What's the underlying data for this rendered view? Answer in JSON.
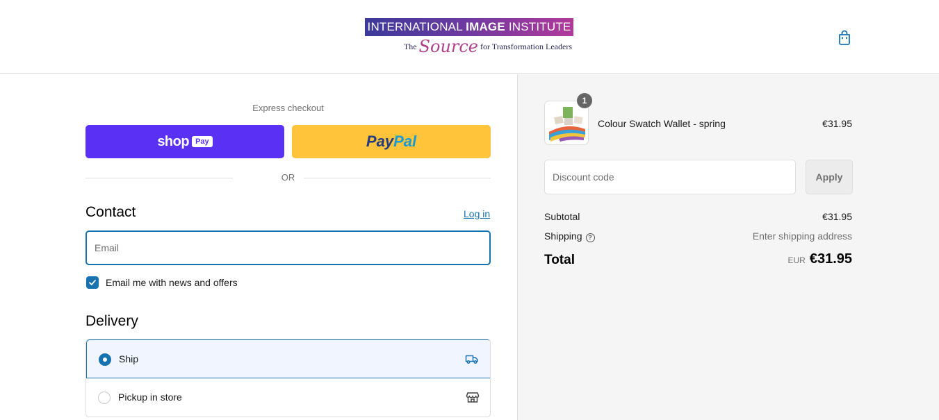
{
  "header": {
    "logo_line1_part1": "INTERNATIONAL ",
    "logo_line1_part2": "IMAGE",
    "logo_line1_part3": " INSTITUTE",
    "logo_line2_the": "The ",
    "logo_line2_source": "Source",
    "logo_line2_rest": " for Transformation Leaders",
    "cart_icon": "shopping-bag-icon"
  },
  "express": {
    "label": "Express checkout",
    "shop_pay_word": "shop",
    "shop_pay_badge": "Pay",
    "paypal_part1": "Pay",
    "paypal_part2": "Pal",
    "or_text": "OR"
  },
  "contact": {
    "heading": "Contact",
    "login_link": "Log in",
    "email_placeholder": "Email",
    "newsletter_label": "Email me with news and offers",
    "newsletter_checked": true
  },
  "delivery": {
    "heading": "Delivery",
    "options": [
      {
        "label": "Ship",
        "selected": true,
        "icon": "truck-icon"
      },
      {
        "label": "Pickup in store",
        "selected": false,
        "icon": "store-icon"
      }
    ]
  },
  "summary": {
    "item": {
      "quantity": "1",
      "name": "Colour Swatch Wallet - spring",
      "price": "€31.95"
    },
    "discount_placeholder": "Discount code",
    "apply_label": "Apply",
    "subtotal_label": "Subtotal",
    "subtotal_value": "€31.95",
    "shipping_label": "Shipping",
    "shipping_value": "Enter shipping address",
    "total_label": "Total",
    "total_currency": "EUR",
    "total_value": "€31.95"
  },
  "colors": {
    "accent": "#1773b0",
    "shop_pay": "#5a31f4",
    "paypal": "#ffc439",
    "summary_bg": "#f5f5f5"
  }
}
